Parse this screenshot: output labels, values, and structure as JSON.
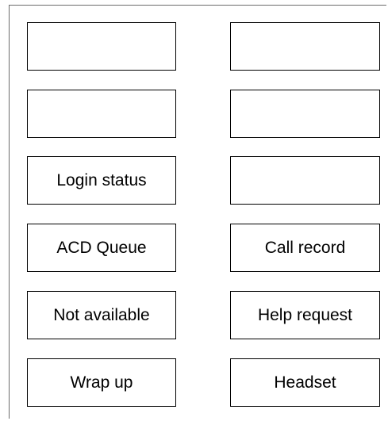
{
  "keys": {
    "left": [
      "",
      "",
      "Login status",
      "ACD Queue",
      "Not available",
      "Wrap up"
    ],
    "right": [
      "",
      "",
      "",
      "Call record",
      "Help request",
      "Headset"
    ]
  }
}
